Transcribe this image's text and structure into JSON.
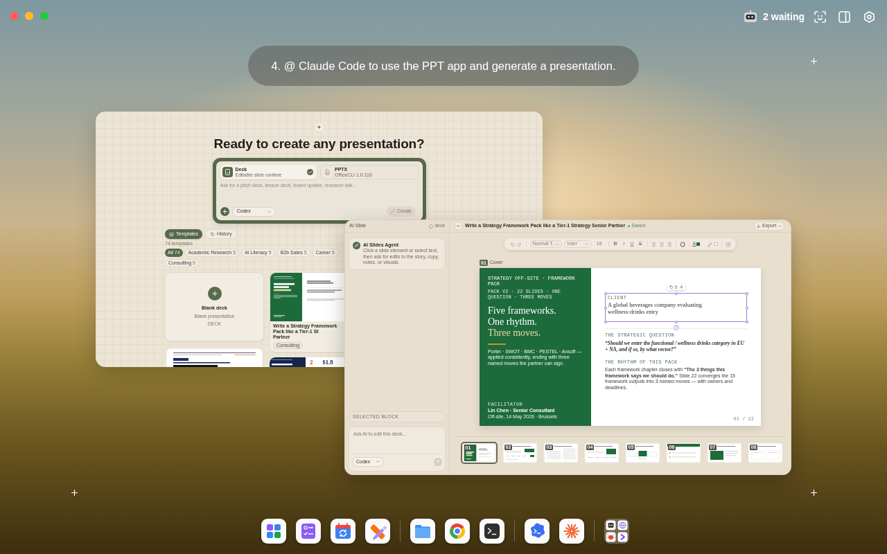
{
  "menu_bar": {
    "waiting": "2 waiting"
  },
  "banner": {
    "text": "4. @ Claude Code to use the PPT app and generate a presentation."
  },
  "create_window": {
    "title": "Ready to create any presentation?",
    "formats": [
      {
        "kind": "deck",
        "name": "Deck",
        "subtitle": "Editable slide runtime",
        "selected": true
      },
      {
        "kind": "file",
        "name": "PPTX",
        "subtitle": "OfficeCLI 1.0.116",
        "selected": false
      }
    ],
    "prompt": {
      "placeholder": "Ask for a pitch deck, lesson deck, board update, research talk..."
    },
    "model": "Codex",
    "create_button": {
      "label": "Create",
      "disabled": true
    },
    "tabs": [
      {
        "kind": "layers",
        "label": "Templates",
        "selected": true
      },
      {
        "kind": "history",
        "label": "History",
        "selected": false
      }
    ],
    "template_count": "74 templates",
    "filters": [
      {
        "label": "All",
        "count": "74",
        "selected": true
      },
      {
        "label": "Academic Research",
        "count": "5",
        "selected": false
      },
      {
        "label": "Ai Literacy",
        "count": "5",
        "selected": false
      },
      {
        "label": "B2b Sales",
        "count": "5",
        "selected": false
      },
      {
        "label": "Career",
        "count": "5",
        "selected": false
      },
      {
        "label": "Consulting",
        "count": "5",
        "selected": false
      }
    ],
    "templates": [
      {
        "kind": "blank",
        "title": "Blank deck",
        "subtitle": "Blank presentation",
        "type": "DECK"
      },
      {
        "kind": "strategy",
        "title_lines": [
          "Write a Strategy Framework Pack like a Tier-1 St",
          "Partner"
        ],
        "tag": "Consulting"
      },
      {
        "kind": "research"
      },
      {
        "kind": "finance",
        "figures": [
          "2",
          "$1.8"
        ]
      }
    ]
  },
  "editor_window": {
    "sidebar": {
      "title": "AI Slide",
      "mode": "deck",
      "agent": {
        "name": "AI Slides Agent",
        "hint": "Click a slide element or select text, then ask for edits to the story, copy, notes, or visuals."
      },
      "selected_block": "SELECTED BLOCK",
      "input": {
        "placeholder": "Ask AI to edit this deck..."
      },
      "model": "Codex"
    },
    "header": {
      "title": "Write a Strategy Framework Pack like a Tier-1 Strategy Senior Partner",
      "status": "Saved",
      "export": "Export"
    },
    "toolbar": {
      "style": "Normal T...",
      "font": "Inter",
      "size": "16",
      "format_buttons": [
        {
          "kind": "bold",
          "label": "B"
        },
        {
          "kind": "italic",
          "label": "I"
        },
        {
          "kind": "underline",
          "label": "U"
        },
        {
          "kind": "strike",
          "label": "S"
        }
      ],
      "text_color": {
        "label": "A",
        "color": "#1f6b3a"
      },
      "highlight": {
        "color": "#ffffff"
      }
    },
    "slide": {
      "number": "01",
      "name": "Cover",
      "kicker": "STRATEGY OFF-SITE · FRAMEWORK PACK",
      "meta": "PACK V2 · 22 SLIDES · ONE QUESTION · THREE MOVES",
      "title_lines": [
        {
          "text": "Five frameworks.",
          "accent": false
        },
        {
          "text": "One rhythm.",
          "accent": false
        },
        {
          "text": "Three moves.",
          "accent": true
        }
      ],
      "summary": "Porter · SWOT · BMC · PESTEL · Ansoff — applied consistently, ending with three named moves the partner can sign.",
      "facilitator_label": "FACILITATOR",
      "facilitator": "Lin Chen · Senior Consultant",
      "date": "Off-site, 14 May 2026 · Brussels",
      "client": {
        "label": "CLIENT",
        "text": "A global beverages company evaluating wellness-drinks entry",
        "selected": true
      },
      "question_label": "THE STRATEGIC QUESTION",
      "question": "“Should we enter the functional / wellness drinks category in EU + NA, and if so, by what vector?”",
      "rhythm_label": "THE RHYTHM OF THIS PACK",
      "rhythm": "Each framework chapter closes with **“The 3 things this framework says we should do.”** Slide 22 converges the 15 framework outputs into 3 named moves — with owners and deadlines.",
      "page": "01 / 22"
    },
    "thumbnails": [
      {
        "number": "01",
        "kind": "cover",
        "selected": true
      },
      {
        "number": "02",
        "kind": "table",
        "selected": false
      },
      {
        "number": "03",
        "kind": "list",
        "selected": false
      },
      {
        "number": "04",
        "kind": "banner",
        "selected": false
      },
      {
        "number": "05",
        "kind": "flow",
        "selected": false
      },
      {
        "number": "06",
        "kind": "header",
        "selected": false
      },
      {
        "number": "07",
        "kind": "panel",
        "selected": false
      },
      {
        "number": "08",
        "kind": "columns",
        "selected": false
      }
    ]
  },
  "dock": [
    {
      "kind": "grid"
    },
    {
      "kind": "checklist"
    },
    {
      "kind": "calendar"
    },
    {
      "kind": "design"
    },
    {
      "kind": "separator"
    },
    {
      "kind": "folder"
    },
    {
      "kind": "ring"
    },
    {
      "kind": "terminal"
    },
    {
      "kind": "separator"
    },
    {
      "kind": "cloud"
    },
    {
      "kind": "starburst"
    },
    {
      "kind": "separator"
    },
    {
      "kind": "group"
    }
  ]
}
